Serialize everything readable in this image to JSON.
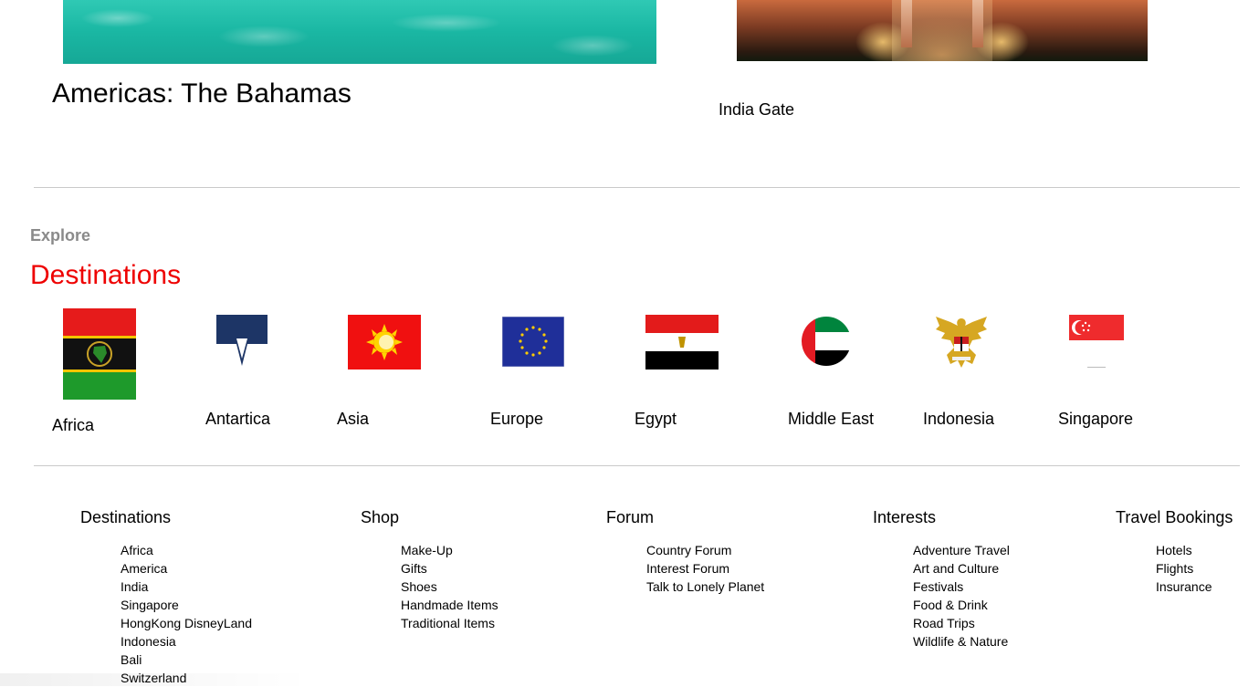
{
  "features": {
    "left_title": "Americas: The Bahamas",
    "right_caption": "India Gate"
  },
  "explore": {
    "kicker": "Explore",
    "heading": "Destinations",
    "flags": [
      {
        "label": "Africa",
        "icon": "african-union-flag-icon"
      },
      {
        "label": "Antartica",
        "icon": "antarctica-flag-icon"
      },
      {
        "label": "Asia",
        "icon": "asia-sun-flag-icon"
      },
      {
        "label": "Europe",
        "icon": "european-union-flag-icon"
      },
      {
        "label": "Egypt",
        "icon": "egypt-flag-icon"
      },
      {
        "label": "Middle East",
        "icon": "uae-flag-icon"
      },
      {
        "label": "Indonesia",
        "icon": "garuda-emblem-icon"
      },
      {
        "label": "Singapore",
        "icon": "singapore-flag-icon"
      }
    ]
  },
  "footer": {
    "columns": [
      {
        "heading": "Destinations",
        "items": [
          "Africa",
          "America",
          "India",
          "Singapore",
          "HongKong DisneyLand",
          "Indonesia",
          "Bali",
          "Switzerland"
        ]
      },
      {
        "heading": "Shop",
        "items": [
          "Make-Up",
          "Gifts",
          "Shoes",
          "Handmade Items",
          "Traditional Items"
        ]
      },
      {
        "heading": "Forum",
        "items": [
          "Country Forum",
          "Interest Forum",
          "Talk to Lonely Planet"
        ]
      },
      {
        "heading": "Interests",
        "items": [
          "Adventure Travel",
          "Art and Culture",
          "Festivals",
          "Food & Drink",
          "Road Trips",
          "Wildlife & Nature"
        ]
      },
      {
        "heading": "Travel Bookings",
        "items": [
          "Hotels",
          "Flights",
          "Insurance"
        ]
      }
    ]
  },
  "colors": {
    "heading_red": "#ee0000",
    "muted_gray": "#8a8a8a",
    "divider": "#c9c9c9"
  }
}
